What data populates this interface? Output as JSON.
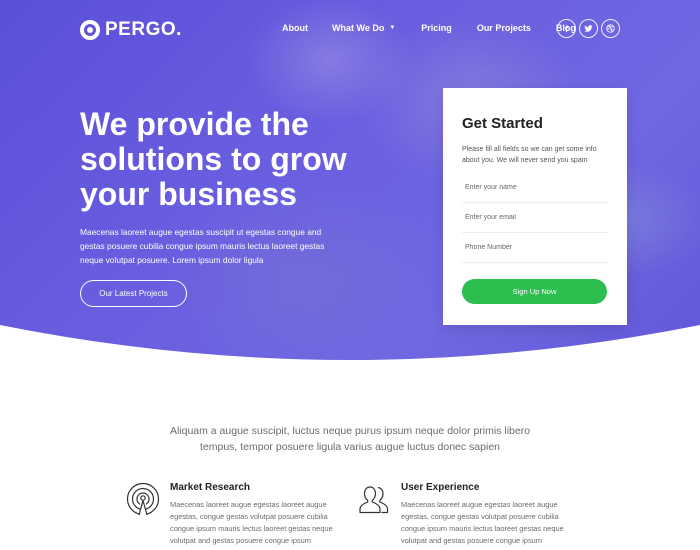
{
  "brand": {
    "name": "PERGO."
  },
  "nav": {
    "items": [
      {
        "label": "About"
      },
      {
        "label": "What We Do",
        "has_dropdown": true
      },
      {
        "label": "Pricing"
      },
      {
        "label": "Our Projects"
      },
      {
        "label": "Blog"
      }
    ]
  },
  "social": [
    {
      "icon": "facebook-icon",
      "glyph": "f"
    },
    {
      "icon": "twitter-icon"
    },
    {
      "icon": "dribbble-icon"
    }
  ],
  "hero": {
    "title_lines": [
      "We provide the",
      "solutions to grow",
      "your business"
    ],
    "description": "Maecenas laoreet augue egestas suscipit ut egestas congue and gestas posuere cubilia congue ipsum mauris lectus laoreet gestas neque volutpat posuere. Lorem ipsum dolor ligula",
    "button_label": "Our Latest Projects"
  },
  "form": {
    "title": "Get Started",
    "description": "Please fill all fields so we can get some info about you. We will never send you spam",
    "name_placeholder": "Enter your name",
    "email_placeholder": "Enter your email",
    "phone_placeholder": "Phone Number",
    "submit_label": "Sign Up Now"
  },
  "intro": {
    "text": "Aliquam a augue suscipit, luctus neque purus ipsum neque dolor primis libero tempus, tempor posuere ligula varius augue luctus donec sapien"
  },
  "features": [
    {
      "icon": "signal-broadcast-icon",
      "title": "Market Research",
      "text": "Maecenas laoreet augue egestas laoreet augue egestas, congue gestas volutpat posuere cubilia congue ipsum mauris lectus laoreet gestas neque volutpat and gestas posuere congue ipsum"
    },
    {
      "icon": "users-icon",
      "title": "User Experience",
      "text": "Maecenas laoreet augue egestas laoreet augue egestas, congue gestas volutpat posuere cubilia congue ipsum mauris lectus laoreet gestas neque volutpat and gestas posuere congue ipsum"
    }
  ],
  "colors": {
    "hero_purple": "#5f57d6",
    "accent_green": "#2ebd4f",
    "heading_dark": "#222222",
    "body_gray": "#6b6b6b"
  }
}
